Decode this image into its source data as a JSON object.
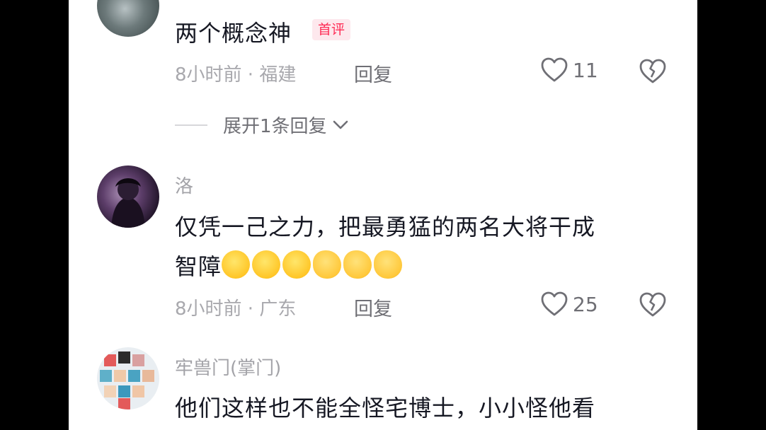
{
  "comments": [
    {
      "username": "",
      "text_lines": [
        "两个概念神"
      ],
      "badge": "首评",
      "time": "8小时前",
      "location": "福建",
      "reply_label": "回复",
      "likes": "11",
      "expand_label": "展开1条回复"
    },
    {
      "username": "洛",
      "text_lines": [
        "仅凭一己之力，把最勇猛的两名大将干成",
        "智障"
      ],
      "emojis": [
        "laugh-cry",
        "laugh-cry",
        "laugh-cry",
        "ok-hand",
        "ok-hand",
        "ok-hand"
      ],
      "time": "8小时前",
      "location": "广东",
      "reply_label": "回复",
      "likes": "25"
    },
    {
      "username": "牢兽门(掌门)",
      "text_lines": [
        "他们这样也不能全怪宅博士，小小怪他看"
      ]
    }
  ],
  "meta_separator": " · ",
  "icons": {
    "like": "heart-outline-icon",
    "dislike": "broken-heart-icon",
    "expand": "chevron-down-icon"
  },
  "colors": {
    "badge_text": "#fe2c55",
    "badge_bg": "#fde8ed",
    "text": "#161823",
    "muted": "#a8a8ad"
  }
}
